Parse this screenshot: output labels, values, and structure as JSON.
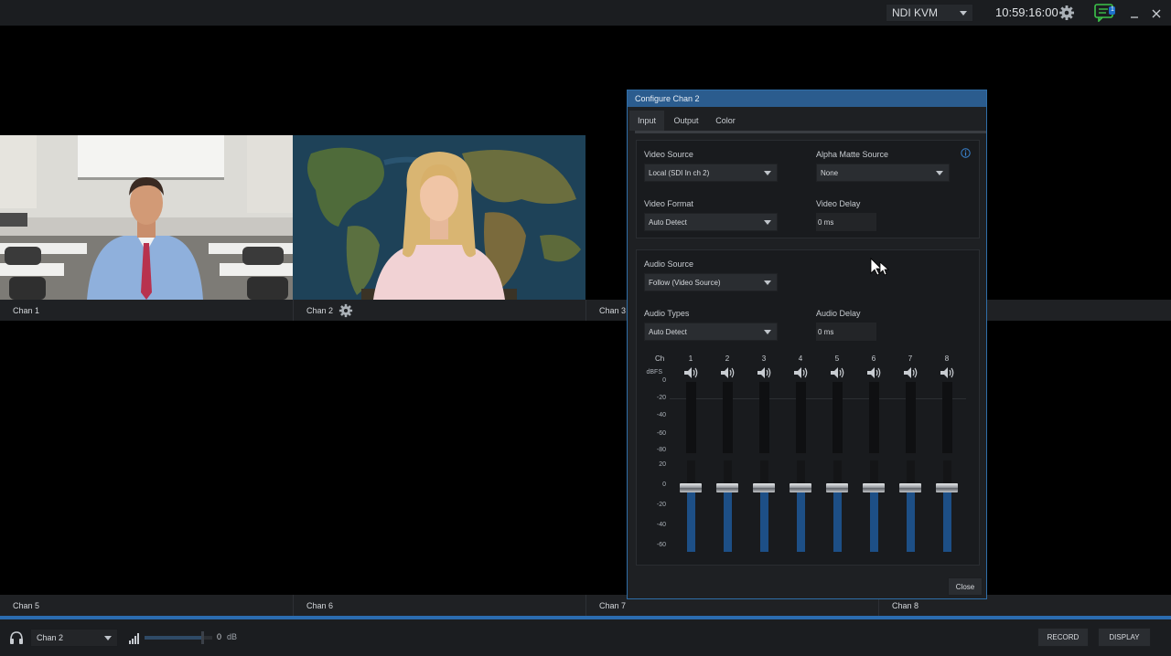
{
  "topbar": {
    "source_select": "NDI KVM",
    "clock": "10:59:16:00",
    "notification_count": "1"
  },
  "channels": [
    {
      "label": "Chan 1"
    },
    {
      "label": "Chan 2"
    },
    {
      "label": "Chan 3"
    },
    {
      "label": "Chan 5"
    },
    {
      "label": "Chan 6"
    },
    {
      "label": "Chan 7"
    },
    {
      "label": "Chan 8"
    }
  ],
  "dialog": {
    "title": "Configure Chan 2",
    "tabs": [
      "Input",
      "Output",
      "Color"
    ],
    "active_tab": "Input",
    "video_source_label": "Video Source",
    "video_source_value": "Local (SDI In ch 2)",
    "alpha_matte_label": "Alpha Matte Source",
    "alpha_matte_value": "None",
    "video_format_label": "Video Format",
    "video_format_value": "Auto Detect",
    "video_delay_label": "Video Delay",
    "video_delay_value": "0 ms",
    "audio_source_label": "Audio Source",
    "audio_source_value": "Follow (Video Source)",
    "audio_types_label": "Audio Types",
    "audio_types_value": "Auto Detect",
    "audio_delay_label": "Audio Delay",
    "audio_delay_value": "0 ms",
    "mixer": {
      "ch_label": "Ch",
      "dbfs_label": "dBFS",
      "channels": [
        "1",
        "2",
        "3",
        "4",
        "5",
        "6",
        "7",
        "8"
      ],
      "meter_scale": [
        "0",
        "-20",
        "-40",
        "-60",
        "-80"
      ],
      "fader_scale": [
        "20",
        "0",
        "-20",
        "-40",
        "-60"
      ],
      "fader_levels_db": [
        0,
        0,
        0,
        0,
        0,
        0,
        0,
        0
      ]
    },
    "close_label": "Close"
  },
  "bottombar": {
    "monitor_select": "Chan 2",
    "volume_value": "0",
    "volume_unit": "dB",
    "volume_level": 0.85,
    "record_label": "RECORD",
    "display_label": "DISPLAY"
  },
  "colors": {
    "accent": "#2b6cb0",
    "title_bar": "#2b5c8e",
    "notify_green": "#3cc34a",
    "fader_blue": "#1d4f86"
  }
}
